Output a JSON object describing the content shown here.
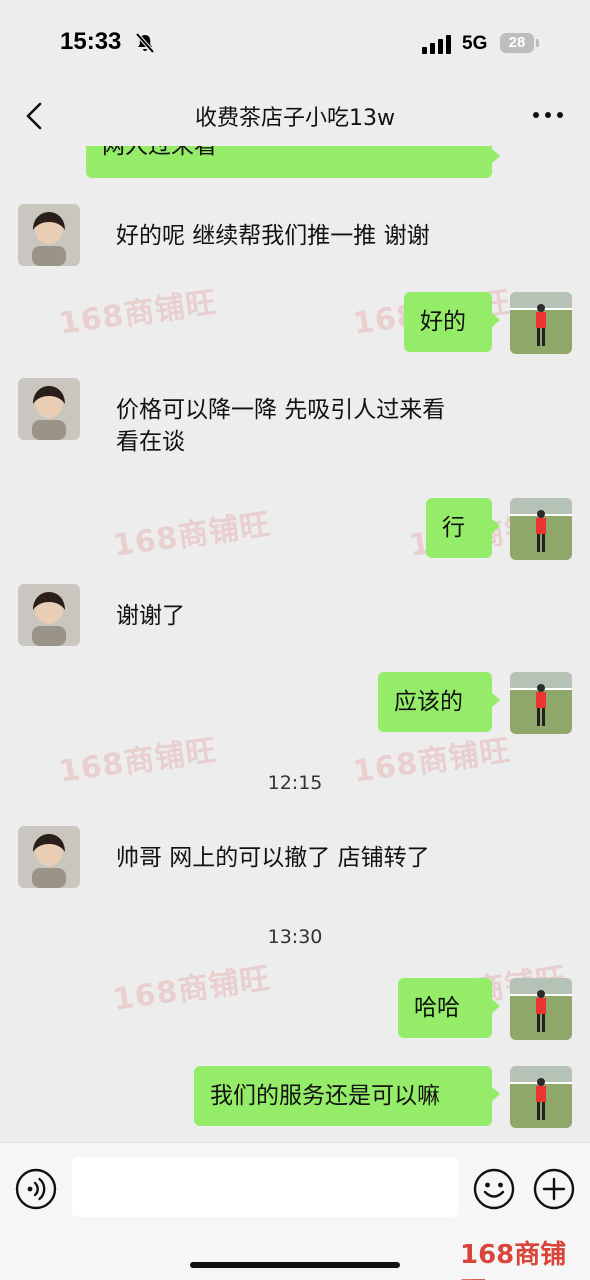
{
  "status_bar": {
    "time": "15:33",
    "network": "5G",
    "battery": "28",
    "mute_icon": "bell-slash-icon",
    "signal_icon": "signal-bars-icon"
  },
  "nav": {
    "title": "收费茶店子小吃13w",
    "back_icon": "chevron-left-icon",
    "more_icon": "more-dots-icon"
  },
  "watermark_text": "168商铺旺",
  "messages": [
    {
      "side": "out",
      "text": "网人过来看",
      "partial": true
    },
    {
      "side": "in",
      "text": "好的呢 继续帮我们推一推 谢谢"
    },
    {
      "side": "out",
      "text": "好的"
    },
    {
      "side": "in",
      "text_line1": "价格可以降一降 先吸引人过来看",
      "text_line2": "看在谈"
    },
    {
      "side": "out",
      "text": "行"
    },
    {
      "side": "in",
      "text": "谢谢了"
    },
    {
      "side": "out",
      "text": "应该的"
    },
    {
      "side": "time",
      "text": "12:15"
    },
    {
      "side": "in",
      "text": "帅哥 网上的可以撤了 店铺转了"
    },
    {
      "side": "time",
      "text": "13:30"
    },
    {
      "side": "out",
      "text": "哈哈"
    },
    {
      "side": "out",
      "text": "我们的服务还是可以嘛"
    }
  ],
  "input_bar": {
    "message_placeholder": "",
    "voice_icon": "voice-icon",
    "emoji_icon": "emoji-icon",
    "plus_icon": "plus-icon"
  },
  "colors": {
    "outgoing_bubble": "#95ec69",
    "background": "#ededed",
    "watermark": "#d8453a"
  }
}
